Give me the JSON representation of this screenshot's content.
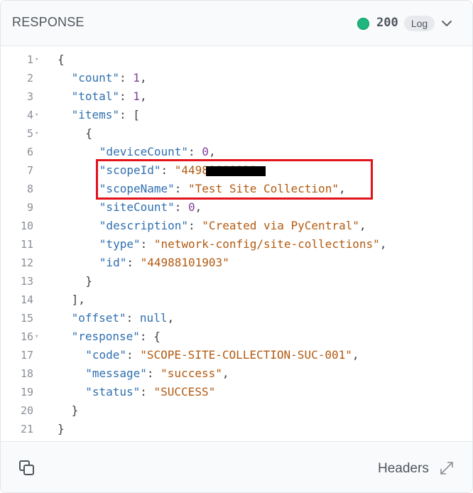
{
  "header": {
    "title": "RESPONSE",
    "status_code": "200",
    "log_label": "Log",
    "status_color": "#1fb57c"
  },
  "code_lines": [
    {
      "num": "1",
      "fold": "▾",
      "indent": 0,
      "tokens": [
        [
          "p",
          "{"
        ]
      ]
    },
    {
      "num": "2",
      "fold": "",
      "indent": 1,
      "tokens": [
        [
          "key",
          "\"count\""
        ],
        [
          "p",
          ": "
        ],
        [
          "num",
          "1"
        ],
        [
          "p",
          ","
        ]
      ]
    },
    {
      "num": "3",
      "fold": "",
      "indent": 1,
      "tokens": [
        [
          "key",
          "\"total\""
        ],
        [
          "p",
          ": "
        ],
        [
          "num",
          "1"
        ],
        [
          "p",
          ","
        ]
      ]
    },
    {
      "num": "4",
      "fold": "▾",
      "indent": 1,
      "tokens": [
        [
          "key",
          "\"items\""
        ],
        [
          "p",
          ": ["
        ]
      ]
    },
    {
      "num": "5",
      "fold": "▾",
      "indent": 2,
      "tokens": [
        [
          "p",
          "{"
        ]
      ]
    },
    {
      "num": "6",
      "fold": "",
      "indent": 3,
      "tokens": [
        [
          "key",
          "\"deviceCount\""
        ],
        [
          "p",
          ": "
        ],
        [
          "num",
          "0"
        ],
        [
          "p",
          ","
        ]
      ]
    },
    {
      "num": "7",
      "fold": "",
      "indent": 3,
      "tokens": [
        [
          "key",
          "\"scopeId\""
        ],
        [
          "p",
          ": "
        ],
        [
          "str",
          "\"4498101903\""
        ],
        [
          "p",
          ","
        ]
      ]
    },
    {
      "num": "8",
      "fold": "",
      "indent": 3,
      "tokens": [
        [
          "key",
          "\"scopeName\""
        ],
        [
          "p",
          ": "
        ],
        [
          "str",
          "\"Test Site Collection\""
        ],
        [
          "p",
          ","
        ]
      ]
    },
    {
      "num": "9",
      "fold": "",
      "indent": 3,
      "tokens": [
        [
          "key",
          "\"siteCount\""
        ],
        [
          "p",
          ": "
        ],
        [
          "num",
          "0"
        ],
        [
          "p",
          ","
        ]
      ]
    },
    {
      "num": "10",
      "fold": "",
      "indent": 3,
      "tokens": [
        [
          "key",
          "\"description\""
        ],
        [
          "p",
          ": "
        ],
        [
          "str",
          "\"Created via PyCentral\""
        ],
        [
          "p",
          ","
        ]
      ]
    },
    {
      "num": "11",
      "fold": "",
      "indent": 3,
      "tokens": [
        [
          "key",
          "\"type\""
        ],
        [
          "p",
          ": "
        ],
        [
          "str",
          "\"network-config/site-collections\""
        ],
        [
          "p",
          ","
        ]
      ]
    },
    {
      "num": "12",
      "fold": "",
      "indent": 3,
      "tokens": [
        [
          "key",
          "\"id\""
        ],
        [
          "p",
          ": "
        ],
        [
          "str",
          "\"44988101903\""
        ]
      ]
    },
    {
      "num": "13",
      "fold": "",
      "indent": 2,
      "tokens": [
        [
          "p",
          "}"
        ]
      ]
    },
    {
      "num": "14",
      "fold": "",
      "indent": 1,
      "tokens": [
        [
          "p",
          "],"
        ]
      ]
    },
    {
      "num": "15",
      "fold": "",
      "indent": 1,
      "tokens": [
        [
          "key",
          "\"offset\""
        ],
        [
          "p",
          ": "
        ],
        [
          "kw",
          "null"
        ],
        [
          "p",
          ","
        ]
      ]
    },
    {
      "num": "16",
      "fold": "▾",
      "indent": 1,
      "tokens": [
        [
          "key",
          "\"response\""
        ],
        [
          "p",
          ": {"
        ]
      ]
    },
    {
      "num": "17",
      "fold": "",
      "indent": 2,
      "tokens": [
        [
          "key",
          "\"code\""
        ],
        [
          "p",
          ": "
        ],
        [
          "str",
          "\"SCOPE-SITE-COLLECTION-SUC-001\""
        ],
        [
          "p",
          ","
        ]
      ]
    },
    {
      "num": "18",
      "fold": "",
      "indent": 2,
      "tokens": [
        [
          "key",
          "\"message\""
        ],
        [
          "p",
          ": "
        ],
        [
          "str",
          "\"success\""
        ],
        [
          "p",
          ","
        ]
      ]
    },
    {
      "num": "19",
      "fold": "",
      "indent": 2,
      "tokens": [
        [
          "key",
          "\"status\""
        ],
        [
          "p",
          ": "
        ],
        [
          "str",
          "\"SUCCESS\""
        ]
      ]
    },
    {
      "num": "20",
      "fold": "",
      "indent": 1,
      "tokens": [
        [
          "p",
          "}"
        ]
      ]
    },
    {
      "num": "21",
      "fold": "",
      "indent": 0,
      "tokens": [
        [
          "p",
          "}"
        ]
      ]
    }
  ],
  "annotation": {
    "color": "#e3121b"
  },
  "footer": {
    "headers_label": "Headers",
    "copy_icon": "copy-icon",
    "expand_icon": "expand-icon"
  }
}
